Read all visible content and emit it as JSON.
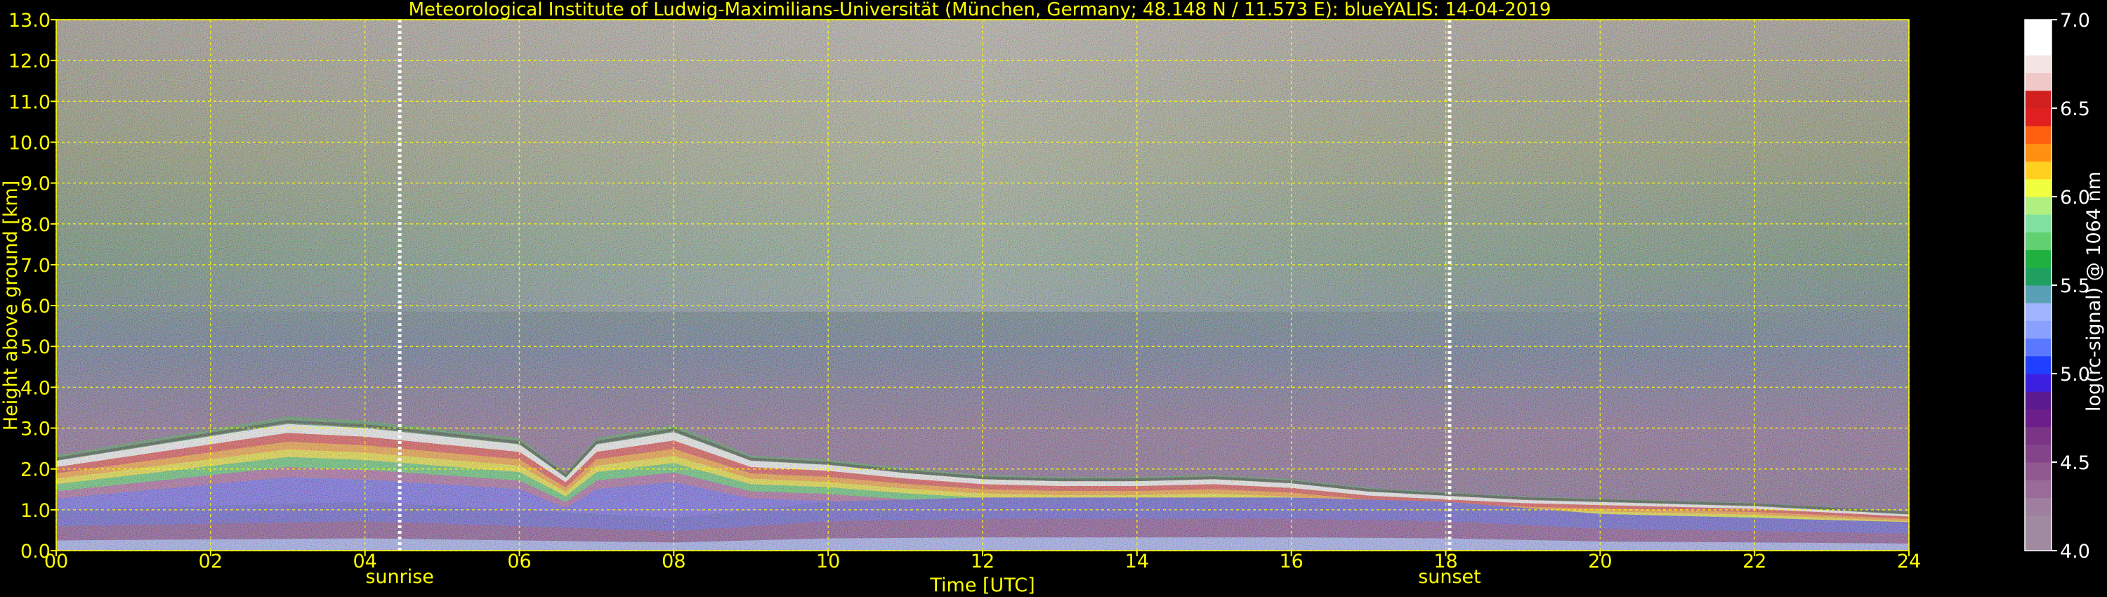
{
  "chart_data": {
    "type": "heatmap",
    "title": "Meteorological Institute of Ludwig-Maximilians-Universität (München, Germany; 48.148 N / 11.573 E):    blueYALIS: 14-04-2019",
    "xlabel": "Time [UTC]",
    "ylabel": "Height above ground [km]",
    "xlim": [
      0,
      24
    ],
    "ylim": [
      0,
      13
    ],
    "x_ticks": [
      "00",
      "02",
      "04",
      "06",
      "08",
      "10",
      "12",
      "14",
      "16",
      "18",
      "20",
      "22",
      "24"
    ],
    "y_ticks": [
      "0.0",
      "1.0",
      "2.0",
      "3.0",
      "4.0",
      "5.0",
      "6.0",
      "7.0",
      "8.0",
      "9.0",
      "10.0",
      "11.0",
      "12.0",
      "13.0"
    ],
    "grid": true,
    "markers": [
      {
        "label": "sunrise",
        "x": 4.45
      },
      {
        "label": "sunset",
        "x": 18.05
      }
    ],
    "colorbar": {
      "label": "log(rc-signal) @ 1064 nm",
      "range": [
        4.0,
        7.0
      ],
      "ticks": [
        "4.0",
        "4.5",
        "5.0",
        "5.5",
        "6.0",
        "6.5",
        "7.0"
      ]
    },
    "layers": {
      "boundary_layer_top_km": {
        "x": [
          0,
          1,
          2,
          3,
          4,
          5,
          6,
          6.6,
          7,
          8,
          9,
          10,
          11,
          12,
          13,
          14,
          15,
          16,
          17,
          18,
          19,
          20,
          21,
          22,
          23,
          24
        ],
        "y": [
          2.2,
          2.5,
          2.8,
          3.1,
          3.0,
          2.8,
          2.6,
          1.8,
          2.6,
          2.9,
          2.2,
          2.1,
          1.9,
          1.75,
          1.7,
          1.7,
          1.75,
          1.65,
          1.45,
          1.35,
          1.25,
          1.2,
          1.15,
          1.1,
          1.0,
          0.9
        ]
      },
      "aerosol_layer_top_km": {
        "x": [
          0,
          2,
          4,
          6,
          8,
          10,
          12,
          14,
          16,
          18,
          20,
          22,
          24
        ],
        "y": [
          1.0,
          1.1,
          1.2,
          1.0,
          0.8,
          1.2,
          1.3,
          1.3,
          1.3,
          1.2,
          0.9,
          0.8,
          0.7
        ]
      }
    }
  },
  "colors": {
    "background": "#000000",
    "axis_text": "#ffff00",
    "grid": "#ffff00",
    "colorbar_text": "#ffffff"
  }
}
